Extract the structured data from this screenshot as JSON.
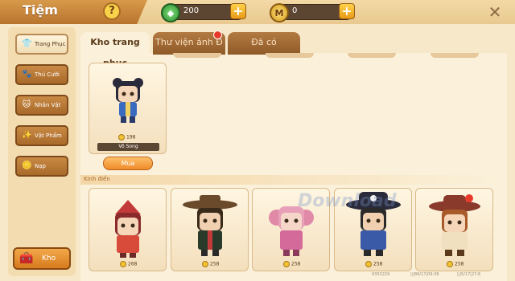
{
  "header": {
    "title": "Tiệm",
    "help_label": "?",
    "close_label": "✕",
    "currencies": [
      {
        "name": "gem",
        "icon": "gem-icon",
        "value": "200",
        "color": "#3fae3a"
      },
      {
        "name": "coin",
        "icon": "coin-icon",
        "value": "0",
        "color": "#f2c232"
      }
    ],
    "plus_label": "+"
  },
  "sidebar": {
    "items": [
      {
        "label": "Trang Phục",
        "icon": "shirt-icon",
        "glyph": "👕",
        "active": true
      },
      {
        "label": "Thú Cưỡi",
        "icon": "mount-icon",
        "glyph": "🐾",
        "active": false
      },
      {
        "label": "Nhân Vật",
        "icon": "character-icon",
        "glyph": "🐱",
        "active": false
      },
      {
        "label": "Vật Phẩm",
        "icon": "item-icon",
        "glyph": "✨",
        "active": false
      },
      {
        "label": "Nạp",
        "icon": "topup-icon",
        "glyph": "🪙",
        "active": false
      }
    ],
    "kho_label": "Kho",
    "kho_glyph": "🧰"
  },
  "tabs": [
    {
      "label": "Kho trang phục",
      "active": true
    },
    {
      "label": "Thư viện ảnh Đ",
      "active": false,
      "badge": true
    },
    {
      "label": "Đã có",
      "active": false
    }
  ],
  "featured": {
    "price": "198",
    "name": "Võ Song",
    "buy_label": "Mua"
  },
  "section": {
    "label": "Kinh điển"
  },
  "row_items": [
    {
      "price": "268",
      "hat": "#c23a3a",
      "outfit": "#d84a3a",
      "hair": "#8a2a2a"
    },
    {
      "price": "258",
      "hat": "#6a4a2a",
      "outfit": "#2a3a2a",
      "hair": "#3a2a1a"
    },
    {
      "price": "258",
      "hat": "#e8a0b8",
      "outfit": "#d46a9a",
      "hair": "#e08aa8"
    },
    {
      "price": "258",
      "hat": "#2a2a3a",
      "outfit": "#3a5aa8",
      "hair": "#2a2a2a"
    },
    {
      "price": "258",
      "hat": "#8a3a2a",
      "outfit": "#f0e0c0",
      "hair": "#a85a2a"
    }
  ],
  "watermark": "Download",
  "footer": {
    "left": "9353229",
    "mid": "|||86/17|09:36",
    "right": "|||5/17|27:6"
  }
}
